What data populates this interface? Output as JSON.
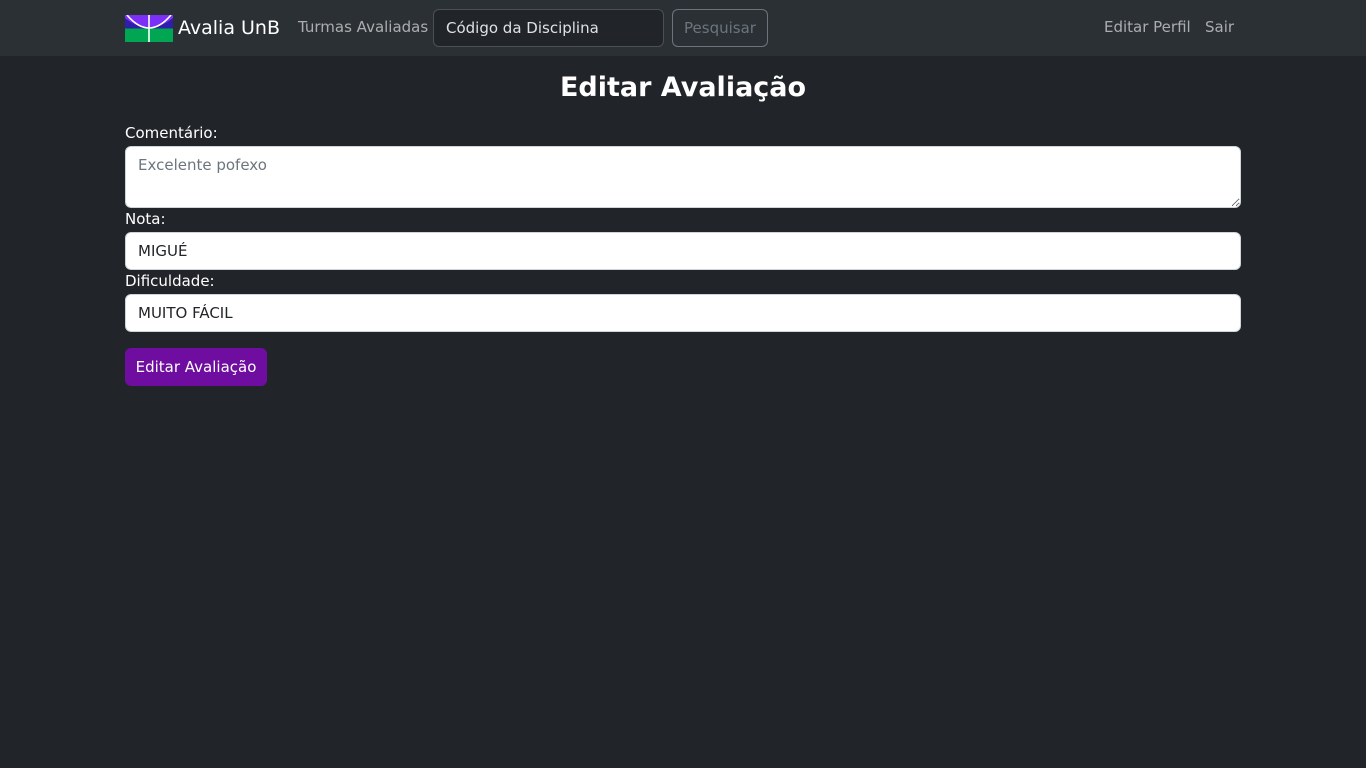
{
  "navbar": {
    "brand": "Avalia UnB",
    "links": {
      "turmas": "Turmas Avaliadas",
      "edit_profile": "Editar Perfil",
      "logout": "Sair"
    },
    "search": {
      "placeholder": "Código da Disciplina",
      "button_label": "Pesquisar"
    }
  },
  "page": {
    "title": "Editar Avaliação"
  },
  "form": {
    "comment_label": "Comentário:",
    "comment_placeholder": "Excelente pofexo",
    "grade_label": "Nota:",
    "grade_value": "MIGUÉ",
    "difficulty_label": "Dificuldade:",
    "difficulty_value": "MUITO FÁCIL",
    "submit_label": "Editar Avaliação"
  },
  "colors": {
    "background": "#212529",
    "navbar": "#2b3035",
    "accent": "#6f0da0",
    "logo_green": "#00a651",
    "logo_blue": "#1f1aa0",
    "logo_purple": "#7b2ff7"
  },
  "icons": {
    "logo": "unb-logo"
  }
}
